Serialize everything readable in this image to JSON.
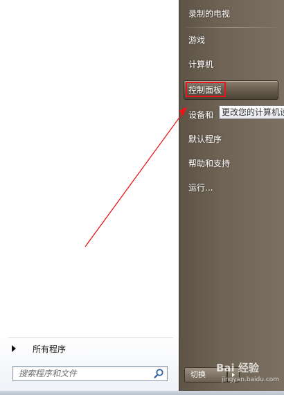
{
  "start_menu": {
    "left": {
      "all_programs": "所有程序",
      "search_placeholder": "搜索程序和文件"
    },
    "right": {
      "items": [
        {
          "label": "录制的电视"
        },
        {
          "label": "游戏"
        },
        {
          "label": "计算机"
        },
        {
          "label": "控制面板"
        },
        {
          "label": "设备和"
        },
        {
          "label": "默认程序"
        },
        {
          "label": "帮助和支持"
        },
        {
          "label": "运行..."
        }
      ],
      "tooltip": "更改您的计算机设",
      "shutdown_label": "切换"
    },
    "watermark": {
      "brand": "Bai 经验",
      "url": "jingyan.baidu.com"
    }
  },
  "colors": {
    "annotation": "#e8161b",
    "right_pane": "#6e6355"
  },
  "icons": {
    "search": "search-icon",
    "all_programs_arrow": "triangle-right-icon"
  }
}
